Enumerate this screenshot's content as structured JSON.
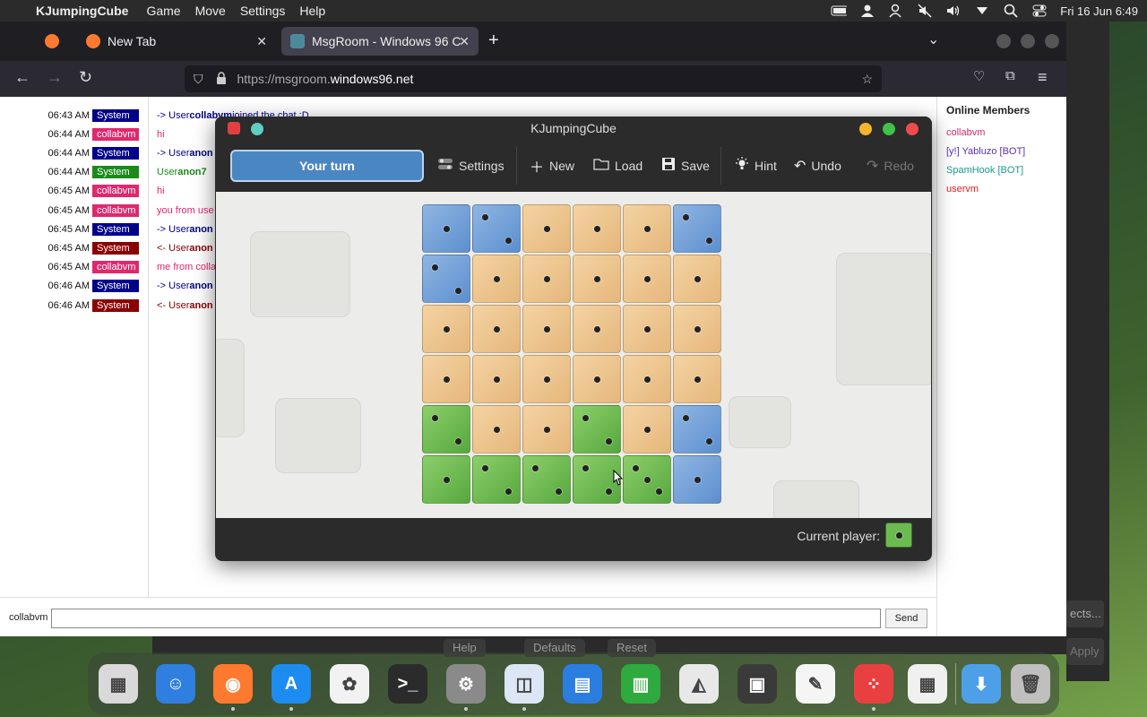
{
  "menubar": {
    "app_name": "KJumpingCube",
    "menus": [
      "Game",
      "Move",
      "Settings",
      "Help"
    ],
    "clock": "Fri 16 Jun  6:49"
  },
  "browser": {
    "tabs": [
      {
        "label": "",
        "favicon": "firefox-icon"
      },
      {
        "label": "New Tab",
        "favicon": "firefox-icon"
      },
      {
        "label": "MsgRoom - Windows 96 C",
        "favicon": "msgroom-icon"
      }
    ],
    "url_prefix": "https://msgroom.",
    "url_host": "windows96.net"
  },
  "chat": {
    "rows": [
      {
        "time": "06:43 AM",
        "user": "System",
        "color": "#00008b",
        "prefix": "-> User ",
        "name": "collabvm",
        "rest": " joined the chat :D",
        "msgcolor": "#00008b"
      },
      {
        "time": "06:44 AM",
        "user": "collabvm",
        "color": "#e0286e",
        "prefix": "hi",
        "name": "",
        "rest": "",
        "msgcolor": "#e0286e"
      },
      {
        "time": "06:44 AM",
        "user": "System",
        "color": "#00008b",
        "prefix": "-> User ",
        "name": "anon",
        "rest": "",
        "msgcolor": "#00008b"
      },
      {
        "time": "06:44 AM",
        "user": "System",
        "color": "#1a8a1a",
        "prefix": "User ",
        "name": "anon7",
        "rest": "",
        "msgcolor": "#1a8a1a"
      },
      {
        "time": "06:45 AM",
        "user": "collabvm",
        "color": "#e0286e",
        "prefix": "hi",
        "name": "",
        "rest": "",
        "msgcolor": "#e0286e"
      },
      {
        "time": "06:45 AM",
        "user": "collabvm",
        "color": "#e0286e",
        "prefix": "you from use",
        "name": "",
        "rest": "",
        "msgcolor": "#e0286e"
      },
      {
        "time": "06:45 AM",
        "user": "System",
        "color": "#00008b",
        "prefix": "-> User ",
        "name": "anon",
        "rest": "",
        "msgcolor": "#00008b"
      },
      {
        "time": "06:45 AM",
        "user": "System",
        "color": "#8b0000",
        "prefix": "<- User ",
        "name": "anon",
        "rest": "",
        "msgcolor": "#8b0000"
      },
      {
        "time": "06:45 AM",
        "user": "collabvm",
        "color": "#e0286e",
        "prefix": "me from colla",
        "name": "",
        "rest": "",
        "msgcolor": "#e0286e"
      },
      {
        "time": "06:46 AM",
        "user": "System",
        "color": "#00008b",
        "prefix": "-> User ",
        "name": "anon",
        "rest": "",
        "msgcolor": "#00008b"
      },
      {
        "time": "06:46 AM",
        "user": "System",
        "color": "#8b0000",
        "prefix": "<- User ",
        "name": "anon",
        "rest": "",
        "msgcolor": "#8b0000"
      }
    ],
    "members_title": "Online Members",
    "members": [
      {
        "name": "collabvm",
        "color": "#e0286e"
      },
      {
        "name": "[y!] Yabluzo [BOT]",
        "color": "#5a2fb0"
      },
      {
        "name": "SpamHook [BOT]",
        "color": "#1a9a8a"
      },
      {
        "name": "uservm",
        "color": "#e02020"
      }
    ],
    "nick": "collabvm",
    "input_value": "",
    "send_label": "Send"
  },
  "background_window": {
    "side_button": "ects...",
    "apply_label": "Apply",
    "bottom_buttons": [
      "Help",
      "Defaults",
      "Reset"
    ]
  },
  "kjc": {
    "title": "KJumpingCube",
    "turn_label": "Your turn",
    "toolbar": {
      "settings": "Settings",
      "new": "New",
      "load": "Load",
      "save": "Save",
      "hint": "Hint",
      "undo": "Undo",
      "redo": "Redo"
    },
    "current_player_label": "Current player:",
    "board": [
      [
        {
          "o": "blue",
          "v": 1
        },
        {
          "o": "blue",
          "v": 2
        },
        {
          "o": "neutral",
          "v": 1
        },
        {
          "o": "neutral",
          "v": 1
        },
        {
          "o": "neutral",
          "v": 1
        },
        {
          "o": "blue",
          "v": 2
        }
      ],
      [
        {
          "o": "blue",
          "v": 2
        },
        {
          "o": "neutral",
          "v": 1
        },
        {
          "o": "neutral",
          "v": 1
        },
        {
          "o": "neutral",
          "v": 1
        },
        {
          "o": "neutral",
          "v": 1
        },
        {
          "o": "neutral",
          "v": 1
        }
      ],
      [
        {
          "o": "neutral",
          "v": 1
        },
        {
          "o": "neutral",
          "v": 1
        },
        {
          "o": "neutral",
          "v": 1
        },
        {
          "o": "neutral",
          "v": 1
        },
        {
          "o": "neutral",
          "v": 1
        },
        {
          "o": "neutral",
          "v": 1
        }
      ],
      [
        {
          "o": "neutral",
          "v": 1
        },
        {
          "o": "neutral",
          "v": 1
        },
        {
          "o": "neutral",
          "v": 1
        },
        {
          "o": "neutral",
          "v": 1
        },
        {
          "o": "neutral",
          "v": 1
        },
        {
          "o": "neutral",
          "v": 1
        }
      ],
      [
        {
          "o": "green",
          "v": 2
        },
        {
          "o": "neutral",
          "v": 1
        },
        {
          "o": "neutral",
          "v": 1
        },
        {
          "o": "green",
          "v": 2
        },
        {
          "o": "neutral",
          "v": 1
        },
        {
          "o": "blue",
          "v": 2
        }
      ],
      [
        {
          "o": "green",
          "v": 1
        },
        {
          "o": "green",
          "v": 2
        },
        {
          "o": "green",
          "v": 2
        },
        {
          "o": "green",
          "v": 2
        },
        {
          "o": "green",
          "v": 3
        },
        {
          "o": "blue",
          "v": 1
        }
      ]
    ],
    "colors": {
      "blue": "#5d8fcf",
      "neutral": "#e5b77c",
      "green": "#56a83e"
    }
  },
  "dock": {
    "apps": [
      {
        "name": "launchpad-icon",
        "bg": "#d9d9d9",
        "glyph": "▦"
      },
      {
        "name": "finder-icon",
        "bg": "#2f7fe0",
        "glyph": "☺"
      },
      {
        "name": "firefox-icon",
        "bg": "#ff7a2e",
        "glyph": "◉"
      },
      {
        "name": "app-store-icon",
        "bg": "#1d8cf0",
        "glyph": "A"
      },
      {
        "name": "photos-icon",
        "bg": "#f2f2f2",
        "glyph": "✿"
      },
      {
        "name": "terminal-icon",
        "bg": "#2b2b2b",
        "glyph": ">_"
      },
      {
        "name": "system-settings-icon",
        "bg": "#8a8a8a",
        "glyph": "⚙"
      },
      {
        "name": "preview-icon",
        "bg": "#dce6f5",
        "glyph": "◫"
      },
      {
        "name": "pages-icon",
        "bg": "#2b7de0",
        "glyph": "▤"
      },
      {
        "name": "numbers-icon",
        "bg": "#2eaa3e",
        "glyph": "▥"
      },
      {
        "name": "keynote-icon",
        "bg": "#e8e8e8",
        "glyph": "◭"
      },
      {
        "name": "recorder-icon",
        "bg": "#3a3a3a",
        "glyph": "▣"
      },
      {
        "name": "textedit-icon",
        "bg": "#f5f5f5",
        "glyph": "✎"
      },
      {
        "name": "kjumpingcube-icon",
        "bg": "#e84040",
        "glyph": "⁘"
      },
      {
        "name": "calculator-icon",
        "bg": "#f0f0f0",
        "glyph": "▦"
      },
      {
        "name": "downloads-icon",
        "bg": "#4da0e8",
        "glyph": "⬇"
      },
      {
        "name": "trash-icon",
        "bg": "#bfbfbf",
        "glyph": "🗑"
      }
    ]
  }
}
